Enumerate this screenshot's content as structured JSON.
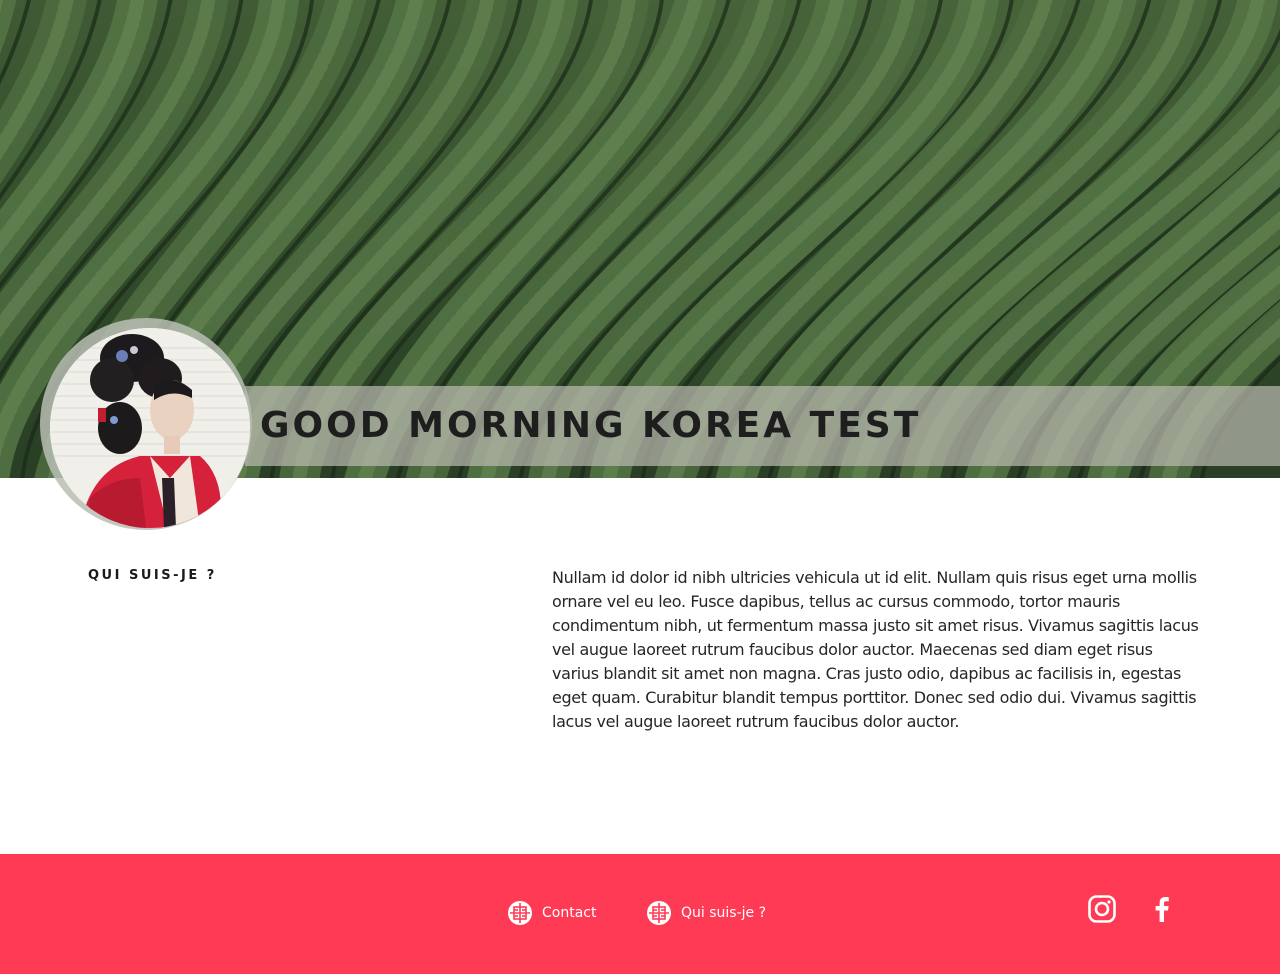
{
  "hero": {
    "title": "GOOD MORNING KOREA TEST"
  },
  "about": {
    "label": "QUI SUIS-JE ?",
    "text": "Nullam id dolor id nibh ultricies vehicula ut id elit. Nullam quis risus eget urna mollis ornare vel eu leo. Fusce dapibus, tellus ac cursus commodo, tortor mauris condimentum nibh, ut fermentum massa justo sit amet risus. Vivamus sagittis lacus vel augue laoreet rutrum faucibus dolor auctor. Maecenas sed diam eget risus varius blandit sit amet non magna. Cras justo odio, dapibus ac facilisis in, egestas eget quam. Curabitur blandit tempus porttitor. Donec sed odio dui. Vivamus sagittis lacus vel augue laoreet rutrum faucibus dolor auctor."
  },
  "footer": {
    "links": [
      {
        "label": "Contact",
        "icon": "korean-emblem-icon"
      },
      {
        "label": "Qui suis-je ?",
        "icon": "korean-emblem-icon"
      }
    ],
    "social": [
      {
        "name": "instagram",
        "icon": "instagram-icon"
      },
      {
        "name": "facebook",
        "icon": "facebook-icon"
      }
    ]
  },
  "colors": {
    "footer_bg": "#ff3a55",
    "title_text": "#1e1e1e",
    "banner": "#b9b9af"
  }
}
